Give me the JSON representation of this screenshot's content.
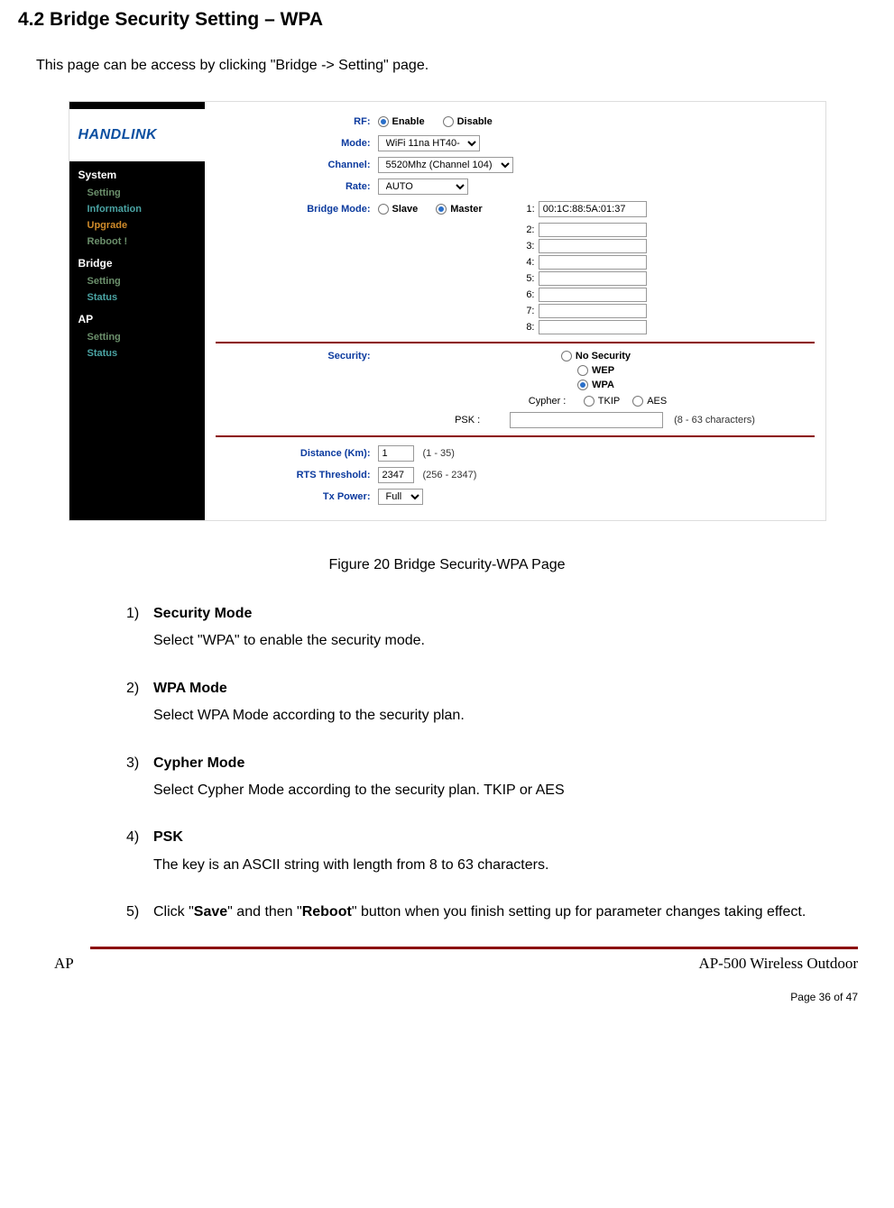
{
  "heading": "4.2    Bridge Security Setting – WPA",
  "intro": "This page can be access by clicking \"Bridge -> Setting\" page.",
  "screenshot": {
    "logo": "HANDLINK",
    "nav": {
      "system": {
        "header": "System",
        "items": [
          "Setting",
          "Information",
          "Upgrade",
          "Reboot !"
        ]
      },
      "bridge": {
        "header": "Bridge",
        "items": [
          "Setting",
          "Status"
        ]
      },
      "ap": {
        "header": "AP",
        "items": [
          "Setting",
          "Status"
        ]
      }
    },
    "form": {
      "rf": {
        "label": "RF:",
        "opt_enable": "Enable",
        "opt_disable": "Disable"
      },
      "mode": {
        "label": "Mode:",
        "value": "WiFi 11na HT40-"
      },
      "channel": {
        "label": "Channel:",
        "value": "5520Mhz (Channel 104)"
      },
      "rate": {
        "label": "Rate:",
        "value": "AUTO"
      },
      "bridge_mode": {
        "label": "Bridge Mode:",
        "opt_slave": "Slave",
        "opt_master": "Master",
        "mac1": "00:1C:88:5A:01:37"
      },
      "security": {
        "label": "Security:",
        "opt_none": "No Security",
        "opt_wep": "WEP",
        "opt_wpa": "WPA",
        "cypher_label": "Cypher :",
        "cypher_tkip": "TKIP",
        "cypher_aes": "AES",
        "psk_label": "PSK :",
        "psk_hint": "(8 - 63 characters)"
      },
      "distance": {
        "label": "Distance (Km):",
        "value": "1",
        "hint": "(1 - 35)"
      },
      "rts": {
        "label": "RTS Threshold:",
        "value": "2347",
        "hint": "(256 - 2347)"
      },
      "txpower": {
        "label": "Tx Power:",
        "value": "Full"
      }
    }
  },
  "figure_caption": "Figure 20    Bridge Security-WPA Page",
  "list": {
    "i1": {
      "num": "1)",
      "title": "Security Mode",
      "desc": "Select \"WPA\" to enable the security mode."
    },
    "i2": {
      "num": "2)",
      "title": "WPA Mode",
      "desc": "Select WPA Mode according to the security plan."
    },
    "i3": {
      "num": "3)",
      "title": "Cypher Mode",
      "desc": "Select Cypher Mode according to the security plan. TKIP or AES"
    },
    "i4": {
      "num": "4)",
      "title": "PSK",
      "desc": "The key is an ASCII string with length from 8 to 63 characters."
    },
    "i5": {
      "num": "5)",
      "pre": "Click \"",
      "b1": "Save",
      "mid": "\" and then \"",
      "b2": "Reboot",
      "post": "\" button when you finish setting up for parameter changes taking effect."
    }
  },
  "footer": {
    "left": "AP",
    "right": "AP-500    Wireless  Outdoor",
    "page": "Page 36 of 47"
  }
}
